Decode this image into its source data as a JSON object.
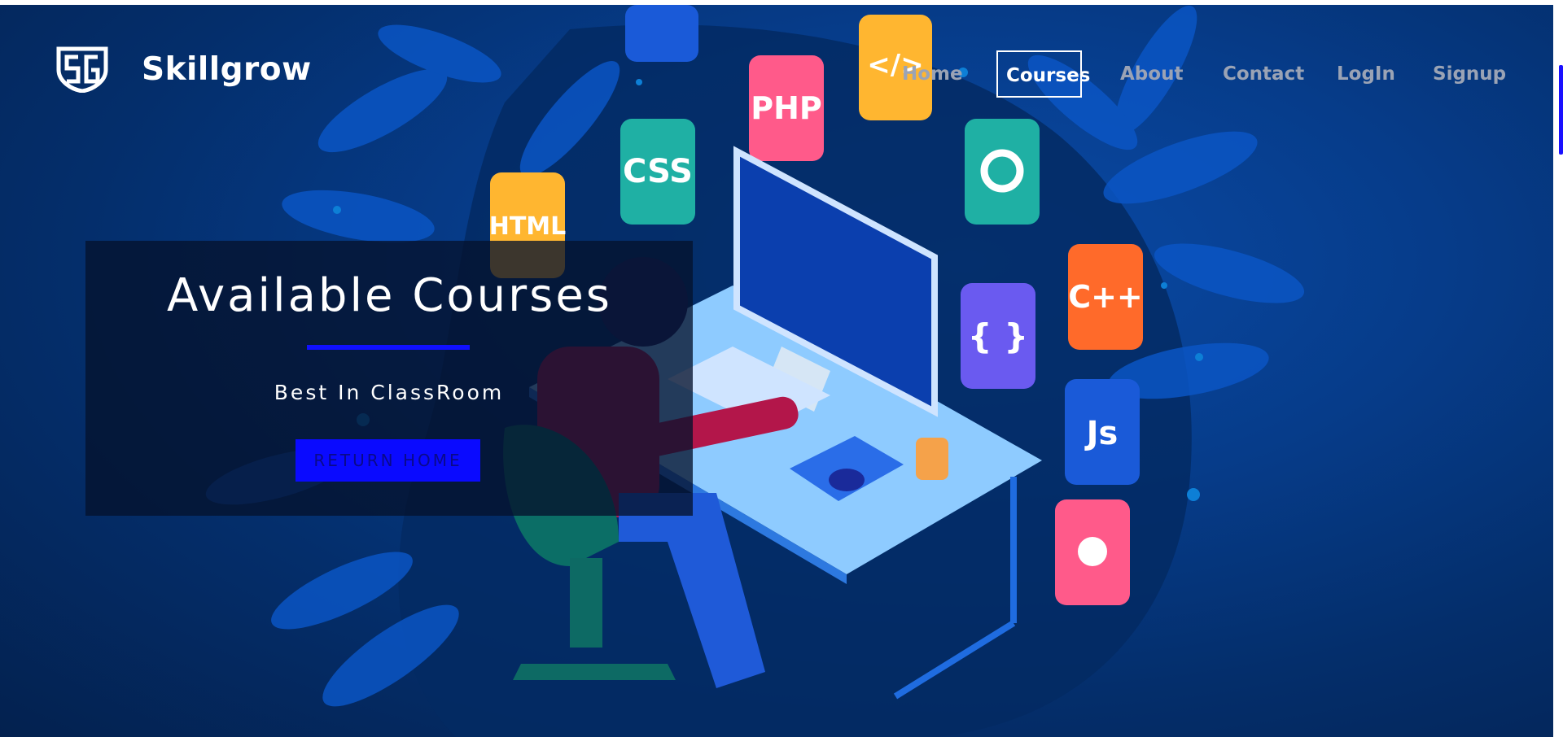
{
  "brand": {
    "name": "Skillgrow",
    "logo_icon": "sg-shield-logo"
  },
  "nav": {
    "items": [
      {
        "label": "Home",
        "active": false
      },
      {
        "label": "Courses",
        "active": true
      },
      {
        "label": "About",
        "active": false
      },
      {
        "label": "Contact",
        "active": false
      },
      {
        "label": "LogIn",
        "active": false
      },
      {
        "label": "Signup",
        "active": false
      }
    ]
  },
  "hero": {
    "title": "Available Courses",
    "subtitle": "Best In ClassRoom",
    "button_label": "RETURN HOME",
    "tiles": [
      "PHP",
      "CSS",
      "HTML",
      "</>",
      "C++",
      "{ }",
      "Js"
    ]
  },
  "colors": {
    "accent": "#0a0aff",
    "background": "#063c8a",
    "panel": "#05122d"
  }
}
